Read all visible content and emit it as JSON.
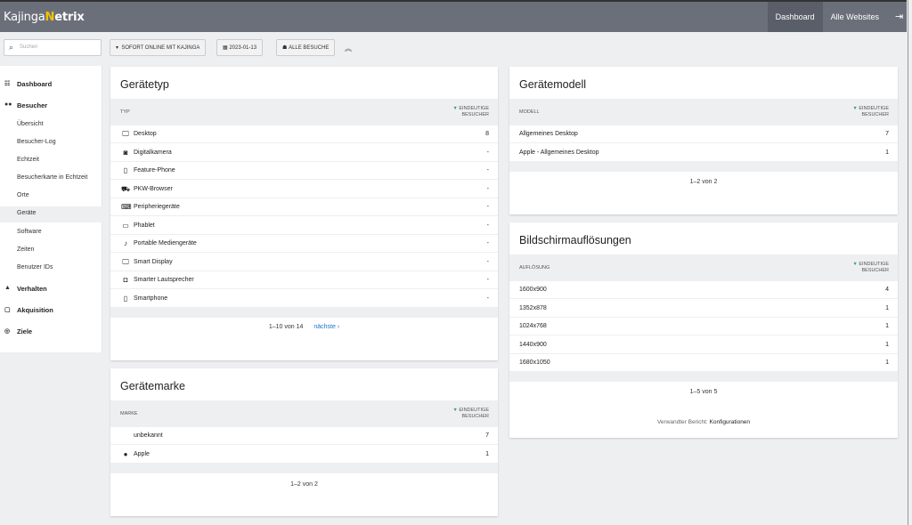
{
  "app": {
    "logo_left": "Kajinga",
    "logo_mid": "N",
    "logo_right": "etrix"
  },
  "topnav": {
    "dashboard": "Dashboard",
    "all_websites": "Alle Websites",
    "logout_icon": "logout-icon"
  },
  "toolbar": {
    "search_placeholder": "Suchen",
    "site_btn": "SOFORT ONLINE MIT KAJINGA",
    "date_btn": "2023-01-13",
    "segment_btn": "ALLE BESUCHE"
  },
  "sidebar": {
    "dashboard": "Dashboard",
    "besucher": "Besucher",
    "items": [
      "Übersicht",
      "Besucher-Log",
      "Echtzeit",
      "Besucherkarte in Echtzeit",
      "Orte",
      "Geräte",
      "Software",
      "Zeiten",
      "Benutzer IDs"
    ],
    "active": "Geräte",
    "verhalten": "Verhalten",
    "akquisition": "Akquisition",
    "ziele": "Ziele"
  },
  "geraetetyp": {
    "title": "Gerätetyp",
    "col1": "TYP",
    "col2a": "EINDEUTIGE",
    "col2b": "BESUCHER",
    "rows": [
      {
        "icon": "desktop-icon",
        "label": "Desktop",
        "value": "8"
      },
      {
        "icon": "camera-icon",
        "label": "Digitalkamera",
        "value": "-"
      },
      {
        "icon": "feature-phone-icon",
        "label": "Feature-Phone",
        "value": "-"
      },
      {
        "icon": "car-icon",
        "label": "PKW-Browser",
        "value": "-"
      },
      {
        "icon": "peripheral-icon",
        "label": "Peripheriegeräte",
        "value": "-"
      },
      {
        "icon": "phablet-icon",
        "label": "Phablet",
        "value": "-"
      },
      {
        "icon": "music-icon",
        "label": "Portable Mediengeräte",
        "value": "-"
      },
      {
        "icon": "smart-display-icon",
        "label": "Smart Display",
        "value": "-"
      },
      {
        "icon": "speaker-icon",
        "label": "Smarter Lautsprecher",
        "value": "-"
      },
      {
        "icon": "smartphone-icon",
        "label": "Smartphone",
        "value": "-"
      }
    ],
    "pager": "1–10 von 14",
    "next": "nächste ›"
  },
  "geraetemarke": {
    "title": "Gerätemarke",
    "col1": "MARKE",
    "col2a": "EINDEUTIGE",
    "col2b": "BESUCHER",
    "rows": [
      {
        "icon": "",
        "label": "unbekannt",
        "value": "7"
      },
      {
        "icon": "apple-icon",
        "label": "Apple",
        "value": "1"
      }
    ],
    "pager": "1–2 von 2"
  },
  "geraetemodell": {
    "title": "Gerätemodell",
    "col1": "MODELL",
    "col2a": "EINDEUTIGE",
    "col2b": "BESUCHER",
    "rows": [
      {
        "label": "Allgemeines Desktop",
        "value": "7"
      },
      {
        "label": "Apple - Allgemeines Desktop",
        "value": "1"
      }
    ],
    "pager": "1–2 von 2"
  },
  "aufloesungen": {
    "title": "Bildschirmauflösungen",
    "col1": "AUFLÖSUNG",
    "col2a": "EINDEUTIGE",
    "col2b": "BESUCHER",
    "rows": [
      {
        "label": "1600x900",
        "value": "4"
      },
      {
        "label": "1352x878",
        "value": "1"
      },
      {
        "label": "1024x768",
        "value": "1"
      },
      {
        "label": "1440x900",
        "value": "1"
      },
      {
        "label": "1680x1050",
        "value": "1"
      }
    ],
    "pager": "1–5 von 5",
    "related_prefix": "Verwandter Bericht:",
    "related_link": "Konfigurationen"
  }
}
